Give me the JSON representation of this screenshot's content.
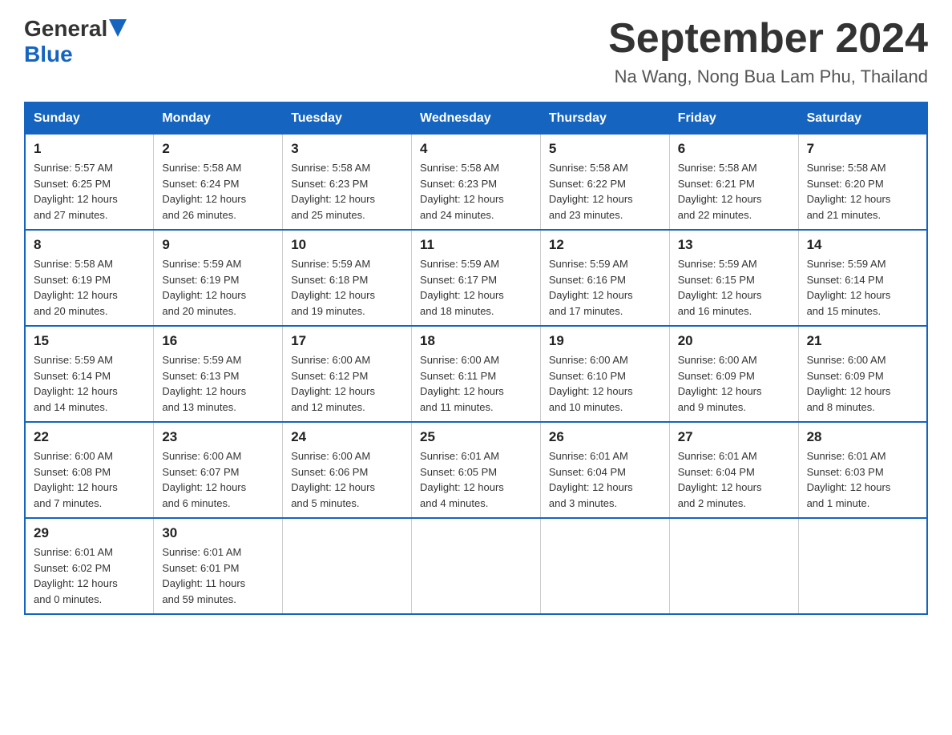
{
  "logo": {
    "general": "General",
    "blue": "Blue"
  },
  "header": {
    "title": "September 2024",
    "subtitle": "Na Wang, Nong Bua Lam Phu, Thailand"
  },
  "columns": [
    "Sunday",
    "Monday",
    "Tuesday",
    "Wednesday",
    "Thursday",
    "Friday",
    "Saturday"
  ],
  "weeks": [
    [
      {
        "day": "1",
        "info": "Sunrise: 5:57 AM\nSunset: 6:25 PM\nDaylight: 12 hours\nand 27 minutes."
      },
      {
        "day": "2",
        "info": "Sunrise: 5:58 AM\nSunset: 6:24 PM\nDaylight: 12 hours\nand 26 minutes."
      },
      {
        "day": "3",
        "info": "Sunrise: 5:58 AM\nSunset: 6:23 PM\nDaylight: 12 hours\nand 25 minutes."
      },
      {
        "day": "4",
        "info": "Sunrise: 5:58 AM\nSunset: 6:23 PM\nDaylight: 12 hours\nand 24 minutes."
      },
      {
        "day": "5",
        "info": "Sunrise: 5:58 AM\nSunset: 6:22 PM\nDaylight: 12 hours\nand 23 minutes."
      },
      {
        "day": "6",
        "info": "Sunrise: 5:58 AM\nSunset: 6:21 PM\nDaylight: 12 hours\nand 22 minutes."
      },
      {
        "day": "7",
        "info": "Sunrise: 5:58 AM\nSunset: 6:20 PM\nDaylight: 12 hours\nand 21 minutes."
      }
    ],
    [
      {
        "day": "8",
        "info": "Sunrise: 5:58 AM\nSunset: 6:19 PM\nDaylight: 12 hours\nand 20 minutes."
      },
      {
        "day": "9",
        "info": "Sunrise: 5:59 AM\nSunset: 6:19 PM\nDaylight: 12 hours\nand 20 minutes."
      },
      {
        "day": "10",
        "info": "Sunrise: 5:59 AM\nSunset: 6:18 PM\nDaylight: 12 hours\nand 19 minutes."
      },
      {
        "day": "11",
        "info": "Sunrise: 5:59 AM\nSunset: 6:17 PM\nDaylight: 12 hours\nand 18 minutes."
      },
      {
        "day": "12",
        "info": "Sunrise: 5:59 AM\nSunset: 6:16 PM\nDaylight: 12 hours\nand 17 minutes."
      },
      {
        "day": "13",
        "info": "Sunrise: 5:59 AM\nSunset: 6:15 PM\nDaylight: 12 hours\nand 16 minutes."
      },
      {
        "day": "14",
        "info": "Sunrise: 5:59 AM\nSunset: 6:14 PM\nDaylight: 12 hours\nand 15 minutes."
      }
    ],
    [
      {
        "day": "15",
        "info": "Sunrise: 5:59 AM\nSunset: 6:14 PM\nDaylight: 12 hours\nand 14 minutes."
      },
      {
        "day": "16",
        "info": "Sunrise: 5:59 AM\nSunset: 6:13 PM\nDaylight: 12 hours\nand 13 minutes."
      },
      {
        "day": "17",
        "info": "Sunrise: 6:00 AM\nSunset: 6:12 PM\nDaylight: 12 hours\nand 12 minutes."
      },
      {
        "day": "18",
        "info": "Sunrise: 6:00 AM\nSunset: 6:11 PM\nDaylight: 12 hours\nand 11 minutes."
      },
      {
        "day": "19",
        "info": "Sunrise: 6:00 AM\nSunset: 6:10 PM\nDaylight: 12 hours\nand 10 minutes."
      },
      {
        "day": "20",
        "info": "Sunrise: 6:00 AM\nSunset: 6:09 PM\nDaylight: 12 hours\nand 9 minutes."
      },
      {
        "day": "21",
        "info": "Sunrise: 6:00 AM\nSunset: 6:09 PM\nDaylight: 12 hours\nand 8 minutes."
      }
    ],
    [
      {
        "day": "22",
        "info": "Sunrise: 6:00 AM\nSunset: 6:08 PM\nDaylight: 12 hours\nand 7 minutes."
      },
      {
        "day": "23",
        "info": "Sunrise: 6:00 AM\nSunset: 6:07 PM\nDaylight: 12 hours\nand 6 minutes."
      },
      {
        "day": "24",
        "info": "Sunrise: 6:00 AM\nSunset: 6:06 PM\nDaylight: 12 hours\nand 5 minutes."
      },
      {
        "day": "25",
        "info": "Sunrise: 6:01 AM\nSunset: 6:05 PM\nDaylight: 12 hours\nand 4 minutes."
      },
      {
        "day": "26",
        "info": "Sunrise: 6:01 AM\nSunset: 6:04 PM\nDaylight: 12 hours\nand 3 minutes."
      },
      {
        "day": "27",
        "info": "Sunrise: 6:01 AM\nSunset: 6:04 PM\nDaylight: 12 hours\nand 2 minutes."
      },
      {
        "day": "28",
        "info": "Sunrise: 6:01 AM\nSunset: 6:03 PM\nDaylight: 12 hours\nand 1 minute."
      }
    ],
    [
      {
        "day": "29",
        "info": "Sunrise: 6:01 AM\nSunset: 6:02 PM\nDaylight: 12 hours\nand 0 minutes."
      },
      {
        "day": "30",
        "info": "Sunrise: 6:01 AM\nSunset: 6:01 PM\nDaylight: 11 hours\nand 59 minutes."
      },
      {
        "day": "",
        "info": ""
      },
      {
        "day": "",
        "info": ""
      },
      {
        "day": "",
        "info": ""
      },
      {
        "day": "",
        "info": ""
      },
      {
        "day": "",
        "info": ""
      }
    ]
  ]
}
